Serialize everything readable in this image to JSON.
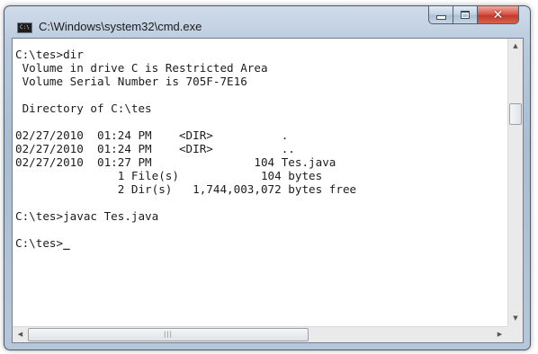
{
  "window": {
    "title": "C:\\Windows\\system32\\cmd.exe",
    "icon_label": "C:\\"
  },
  "console": {
    "lines": [
      "C:\\tes>dir",
      " Volume in drive C is Restricted Area",
      " Volume Serial Number is 705F-7E16",
      "",
      " Directory of C:\\tes",
      "",
      "02/27/2010  01:24 PM    <DIR>          .",
      "02/27/2010  01:24 PM    <DIR>          ..",
      "02/27/2010  01:27 PM               104 Tes.java",
      "               1 File(s)            104 bytes",
      "               2 Dir(s)   1,744,003,072 bytes free",
      "",
      "C:\\tes>javac Tes.java",
      "",
      "C:\\tes>"
    ],
    "cursor": "_"
  },
  "icons": {
    "app": "cmd-icon",
    "minimize": "minimize-icon",
    "maximize": "maximize-icon",
    "close": "close-icon",
    "scroll_up": "arrow-up-icon",
    "scroll_down": "arrow-down-icon",
    "scroll_left": "arrow-left-icon",
    "scroll_right": "arrow-right-icon"
  },
  "colors": {
    "console_background": "#ffffff",
    "console_text": "#1c1c1c",
    "close_button": "#c8392b"
  }
}
